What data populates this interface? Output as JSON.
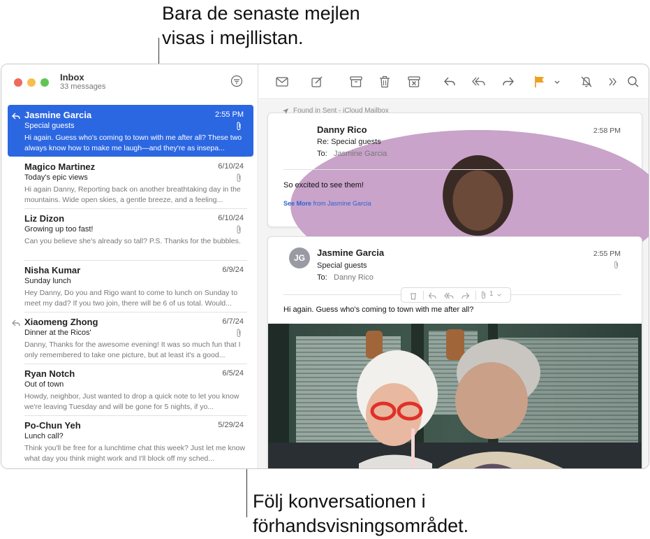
{
  "callouts": {
    "top_line1": "Bara de senaste mejlen",
    "top_line2": "visas i mejllistan.",
    "bottom_line1": "Följ konversationen i",
    "bottom_line2": "förhandsvisningsområdet."
  },
  "mailbox": {
    "title": "Inbox",
    "count": "33 messages"
  },
  "messages": [
    {
      "sender": "Jasmine Garcia",
      "date": "2:55 PM",
      "subject": "Special guests",
      "preview": "Hi again. Guess who's coming to town with me after all? These two always know how to make me laugh—and they're as insepa...",
      "selected": true,
      "replied": true,
      "attachment": true
    },
    {
      "sender": "Magico Martinez",
      "date": "6/10/24",
      "subject": "Today's epic views",
      "preview": "Hi again Danny, Reporting back on another breathtaking day in the mountains. Wide open skies, a gentle breeze, and a feeling...",
      "selected": false,
      "replied": false,
      "attachment": true
    },
    {
      "sender": "Liz Dizon",
      "date": "6/10/24",
      "subject": "Growing up too fast!",
      "preview": "Can you believe she's already so tall? P.S. Thanks for the bubbles.",
      "selected": false,
      "replied": false,
      "attachment": true
    },
    {
      "sender": "Nisha Kumar",
      "date": "6/9/24",
      "subject": "Sunday lunch",
      "preview": "Hey Danny, Do you and Rigo want to come to lunch on Sunday to meet my dad? If you two join, there will be 6 of us total. Would...",
      "selected": false,
      "replied": false,
      "attachment": false
    },
    {
      "sender": "Xiaomeng Zhong",
      "date": "6/7/24",
      "subject": "Dinner at the Ricos'",
      "preview": "Danny, Thanks for the awesome evening! It was so much fun that I only remembered to take one picture, but at least it's a good...",
      "selected": false,
      "replied": true,
      "attachment": true
    },
    {
      "sender": "Ryan Notch",
      "date": "6/5/24",
      "subject": "Out of town",
      "preview": "Howdy, neighbor, Just wanted to drop a quick note to let you know we're leaving Tuesday and will be gone for 5 nights, if yo...",
      "selected": false,
      "replied": false,
      "attachment": false
    },
    {
      "sender": "Po-Chun Yeh",
      "date": "5/29/24",
      "subject": "Lunch call?",
      "preview": "Think you'll be free for a lunchtime chat this week? Just let me know what day you think might work and I'll block off my sched...",
      "selected": false,
      "replied": false,
      "attachment": false
    }
  ],
  "toolbar": {
    "icons": [
      "envelope-icon",
      "compose-icon",
      "archive-icon",
      "trash-icon",
      "junk-icon",
      "reply-icon",
      "reply-all-icon",
      "forward-icon",
      "flag-icon",
      "chevron-down-icon",
      "mute-bell-icon",
      "more-icon",
      "search-icon"
    ],
    "flag_color": "#f0a020"
  },
  "conversation": {
    "found_in": "Found in Sent - iCloud Mailbox",
    "message1": {
      "sender": "Danny Rico",
      "time": "2:58 PM",
      "subject": "Re: Special guests",
      "to_label": "To:",
      "to": "Jasmine Garcia",
      "body": "So excited to see them!",
      "see_more_bold": "See More",
      "see_more_rest": "from Jasmine Garcia"
    },
    "message2": {
      "sender": "Jasmine Garcia",
      "initials": "JG",
      "time": "2:55 PM",
      "subject": "Special guests",
      "to_label": "To:",
      "to": "Danny Rico",
      "body": "Hi again. Guess who's coming to town with me after all?",
      "attachment_count": "1"
    }
  },
  "colors": {
    "accent": "#2c67e2",
    "close": "#ed6a5e",
    "minimize": "#f5bf4f",
    "zoom": "#61c554"
  }
}
